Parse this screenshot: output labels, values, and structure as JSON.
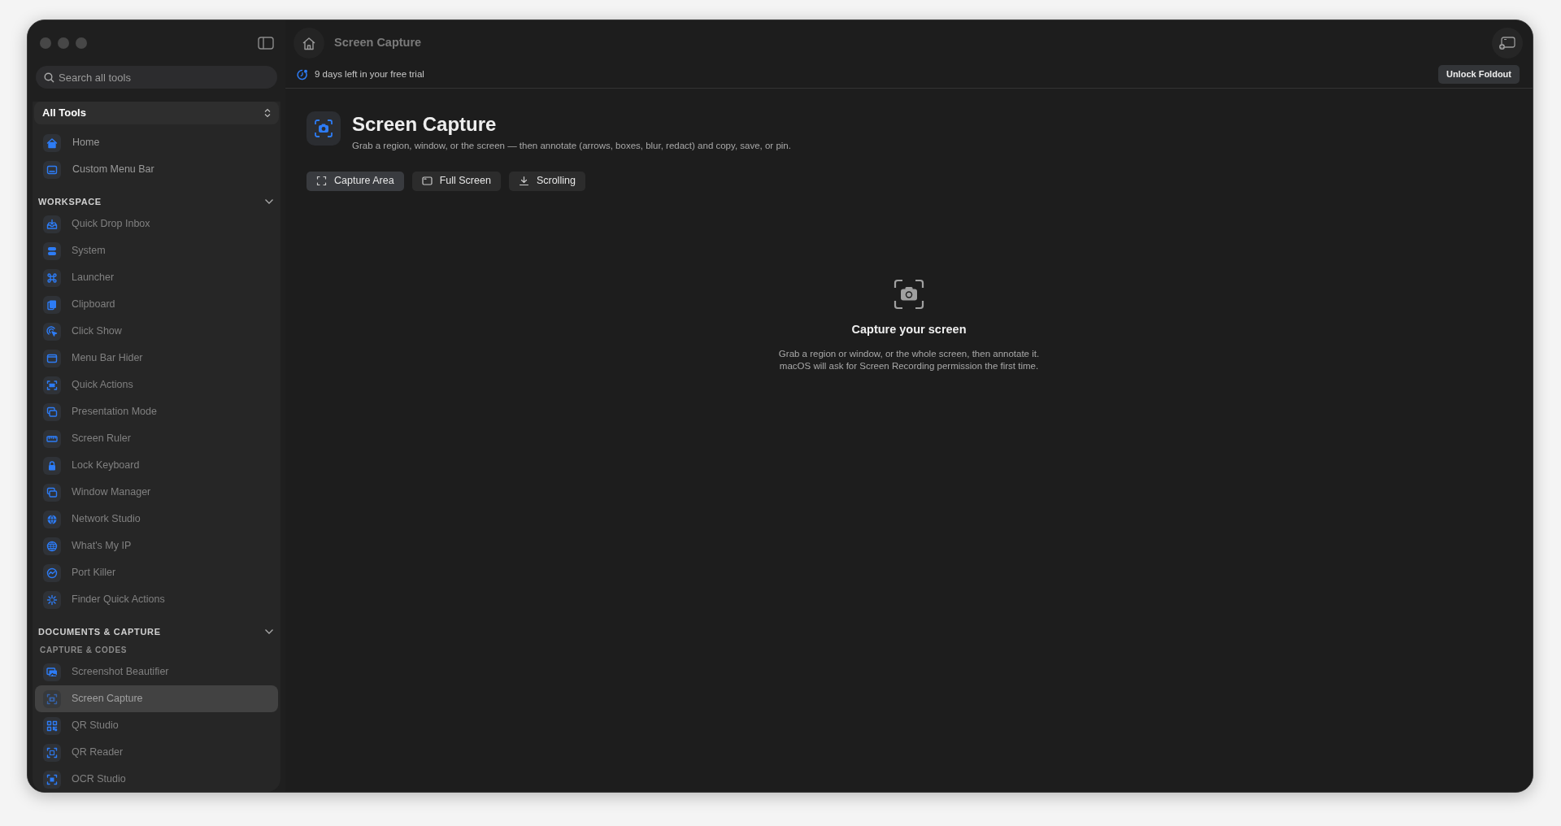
{
  "toolbar": {
    "title": "Screen Capture"
  },
  "sidebar": {
    "search": {
      "placeholder": "Search all tools"
    },
    "scope": "All Tools",
    "items": [
      {
        "label": "Home",
        "selected": false
      },
      {
        "label": "Custom Menu Bar",
        "selected": false
      }
    ],
    "sections": [
      {
        "title": "WORKSPACE",
        "expanded": true,
        "groups": [
          {
            "items": [
              {
                "label": "Quick Drop Inbox",
                "selected": false
              },
              {
                "label": "System",
                "selected": false
              },
              {
                "label": "Launcher",
                "selected": false
              },
              {
                "label": "Clipboard",
                "selected": false
              },
              {
                "label": "Click Show",
                "selected": false
              },
              {
                "label": "Menu Bar Hider",
                "selected": false
              },
              {
                "label": "Quick Actions",
                "selected": false
              },
              {
                "label": "Presentation Mode",
                "selected": false
              },
              {
                "label": "Screen Ruler",
                "selected": false
              },
              {
                "label": "Lock Keyboard",
                "selected": false
              },
              {
                "label": "Window Manager",
                "selected": false
              },
              {
                "label": "Network Studio",
                "selected": false
              },
              {
                "label": "What's My IP",
                "selected": false
              },
              {
                "label": "Port Killer",
                "selected": false
              },
              {
                "label": "Finder Quick Actions",
                "selected": false
              }
            ]
          }
        ]
      },
      {
        "title": "DOCUMENTS & CAPTURE",
        "expanded": true,
        "groups": [
          {
            "title": "CAPTURE & CODES",
            "items": [
              {
                "label": "Screenshot Beautifier",
                "selected": false
              },
              {
                "label": "Screen Capture",
                "selected": true
              },
              {
                "label": "QR Studio",
                "selected": false
              },
              {
                "label": "QR Reader",
                "selected": false
              },
              {
                "label": "OCR Studio",
                "selected": false
              }
            ]
          }
        ]
      }
    ]
  },
  "trial_banner": {
    "text": "9 days left in your free trial",
    "button": "Unlock Foldout"
  },
  "tool": {
    "title": "Screen Capture",
    "description": "Grab a region, window, or the screen — then annotate (arrows, boxes, blur, redact) and copy, save, or pin.",
    "actions": [
      {
        "label": "Capture Area",
        "selected": true
      },
      {
        "label": "Full Screen",
        "selected": false
      },
      {
        "label": "Scrolling",
        "selected": false
      }
    ]
  },
  "empty_state": {
    "title": "Capture your screen",
    "lines": [
      "Grab a region or window, or the whole screen, then annotate it.",
      "macOS will ask for Screen Recording permission the first time."
    ]
  }
}
